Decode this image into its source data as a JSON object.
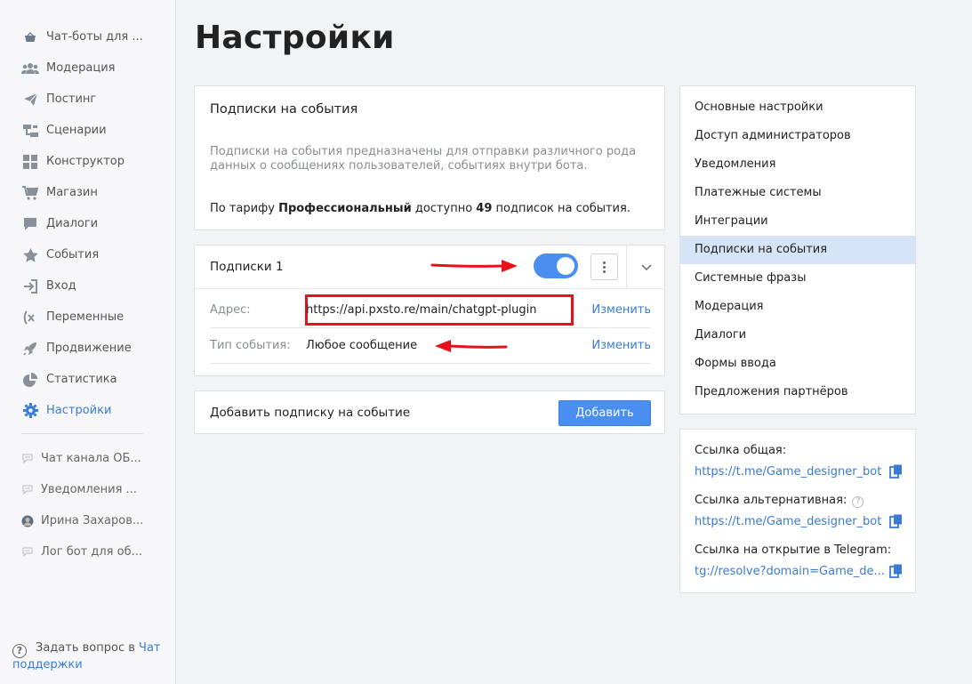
{
  "sidebar": {
    "items": [
      {
        "label": "Чат-боты для ...",
        "icon": "basket-icon"
      },
      {
        "label": "Модерация",
        "icon": "users-icon"
      },
      {
        "label": "Постинг",
        "icon": "send-icon"
      },
      {
        "label": "Сценарии",
        "icon": "scenario-icon"
      },
      {
        "label": "Конструктор",
        "icon": "grid-icon"
      },
      {
        "label": "Магазин",
        "icon": "cart-icon"
      },
      {
        "label": "Диалоги",
        "icon": "chat-icon"
      },
      {
        "label": "События",
        "icon": "star-icon"
      },
      {
        "label": "Вход",
        "icon": "login-icon"
      },
      {
        "label": "Переменные",
        "icon": "variable-icon"
      },
      {
        "label": "Продвижение",
        "icon": "rocket-icon"
      },
      {
        "label": "Статистика",
        "icon": "pie-icon"
      },
      {
        "label": "Настройки",
        "icon": "gear-icon",
        "active": true
      }
    ],
    "chats": [
      {
        "label": "Чат канала ОБ...",
        "icon": "speech-bubble-icon"
      },
      {
        "label": "Уведомления ...",
        "icon": "speech-bubble-icon"
      },
      {
        "label": "Ирина Захаров...",
        "icon": "avatar-icon"
      },
      {
        "label": "Лог бот для об...",
        "icon": "speech-bubble-icon"
      }
    ],
    "help_text": "Задать вопрос в",
    "help_link": "Чат поддержки"
  },
  "page": {
    "title": "Настройки"
  },
  "info": {
    "title": "Подписки на события",
    "description": "Подписки на события предназначены для отправки различного рода данных о сообщениях пользователей, событиях внутри бота.",
    "tariff_prefix": "По тарифу",
    "tariff_name": "Профессиональный",
    "tariff_middle": "доступно",
    "tariff_count": "49",
    "tariff_suffix": "подписок на события."
  },
  "subscription": {
    "name": "Подписки 1",
    "enabled": true,
    "address_label": "Адрес:",
    "address_value": "https://api.pxsto.re/main/chatgpt-plugin",
    "event_label": "Тип события:",
    "event_value": "Любое сообщение",
    "change_label": "Изменить"
  },
  "add": {
    "label": "Добавить подписку на событие",
    "button": "Добавить"
  },
  "settings_menu": {
    "items": [
      "Основные настройки",
      "Доступ администраторов",
      "Уведомления",
      "Платежные системы",
      "Интеграции",
      "Подписки на события",
      "Системные фразы",
      "Модерация",
      "Диалоги",
      "Формы ввода",
      "Предложения партнёров"
    ],
    "active_index": 5
  },
  "links": {
    "general_label": "Ссылка общая:",
    "general_url": "https://t.me/Game_designer_bot",
    "alt_label": "Ссылка альтернативная:",
    "alt_url": "https://t.me/Game_designer_bot",
    "telegram_label": "Ссылка на открытие в Telegram:",
    "telegram_url": "tg://resolve?domain=Game_de..."
  },
  "colors": {
    "accent": "#4a8ef0",
    "link": "#3a7bd5",
    "annotation": "#e8101a",
    "active_bg": "#d6e4f7"
  }
}
